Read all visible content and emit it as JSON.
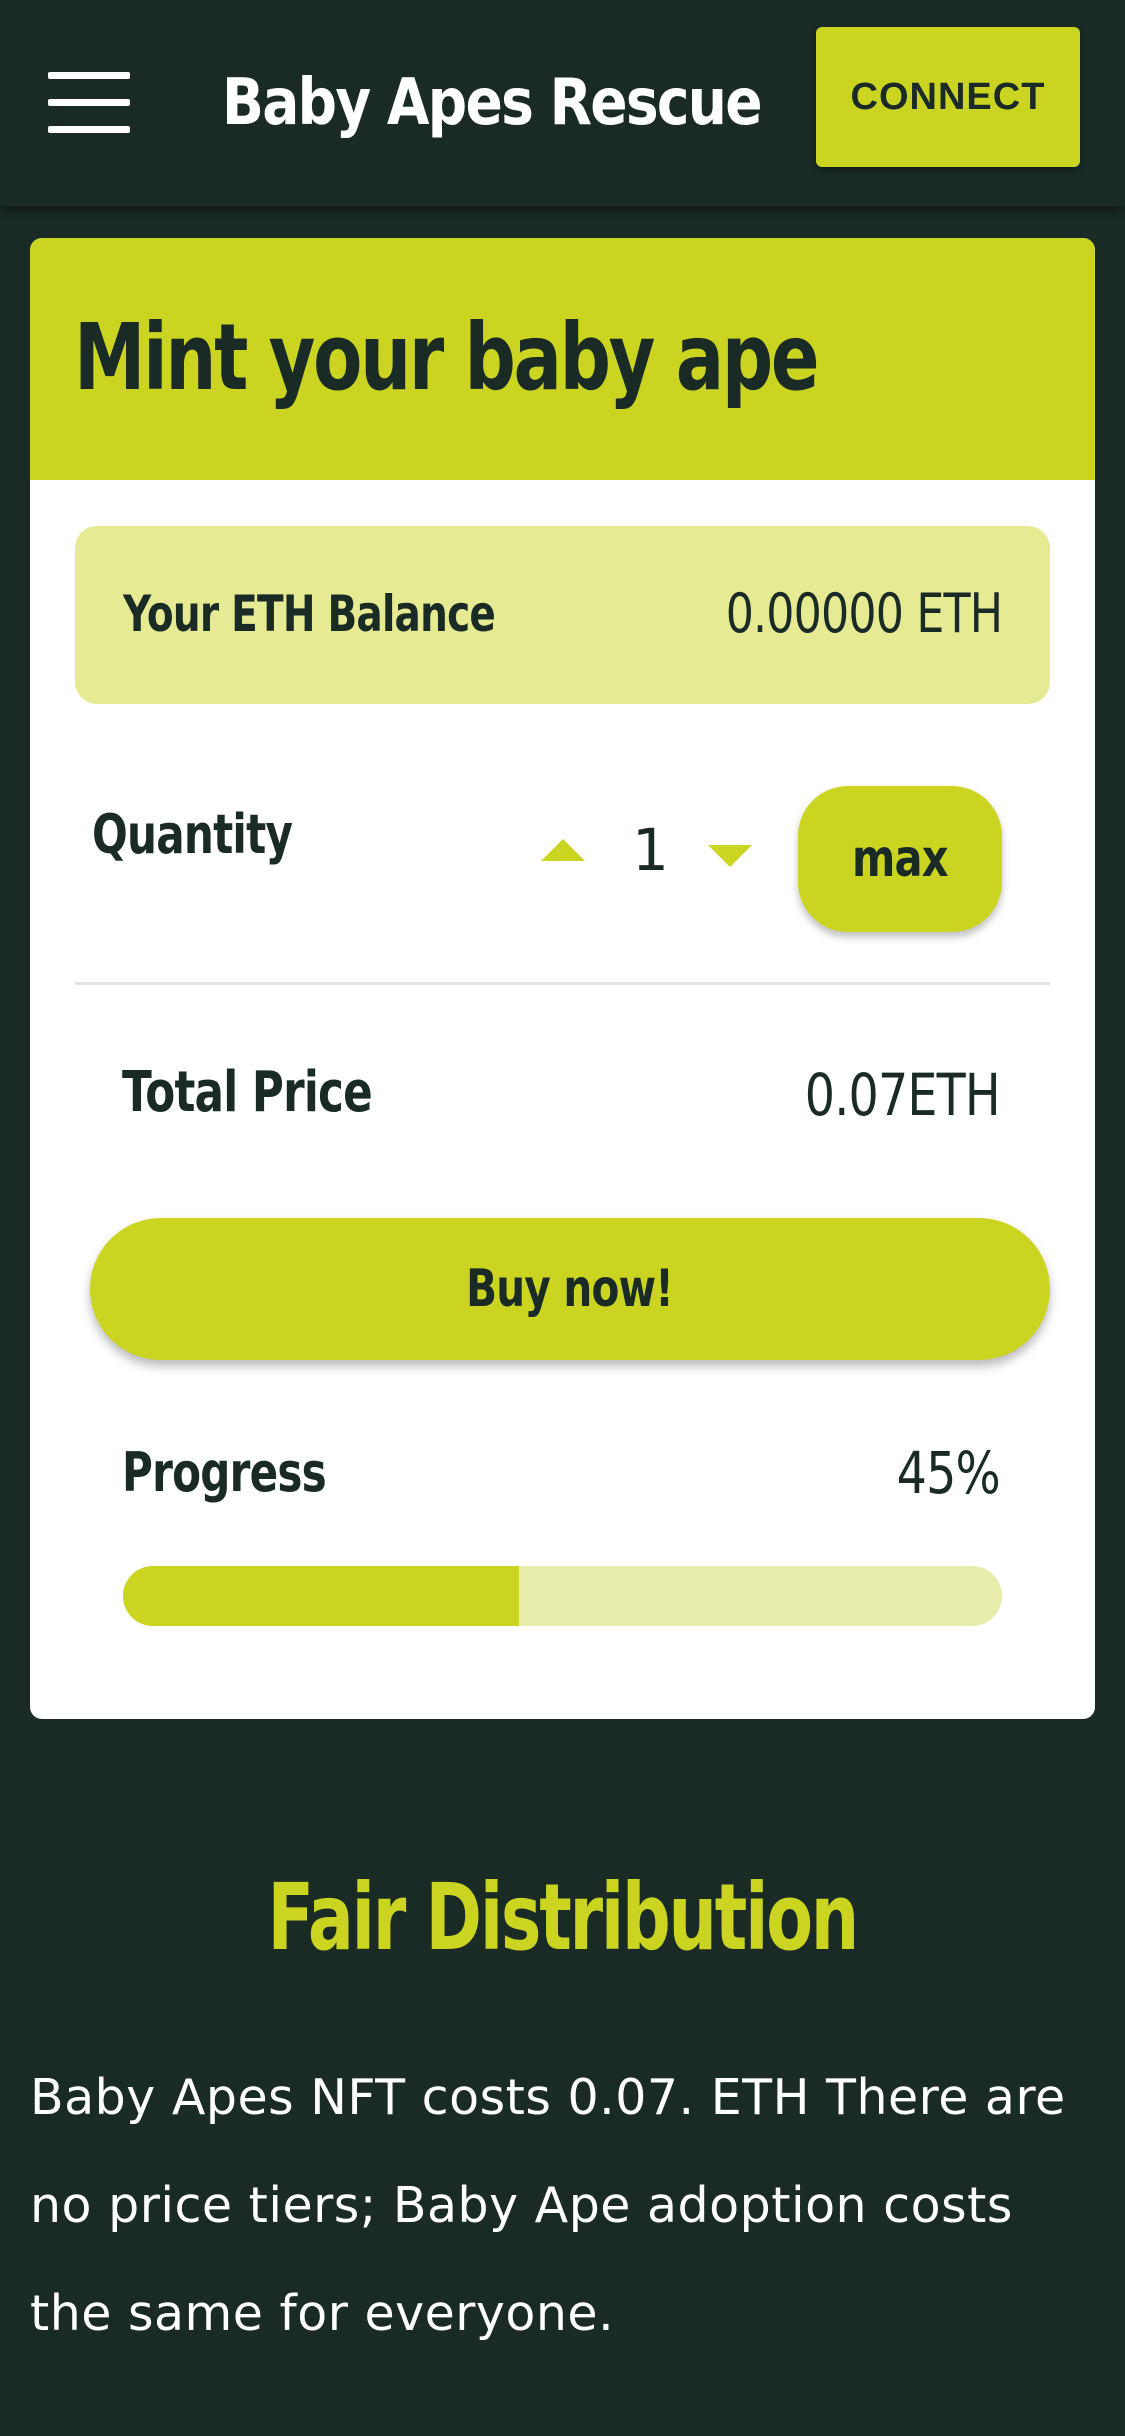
{
  "header": {
    "menu_icon": "hamburger-menu-icon",
    "brand": "Baby Apes Rescue",
    "connect_label": "CONNECT"
  },
  "mint_card": {
    "title": "Mint your baby ape",
    "balance": {
      "label": "Your ETH Balance",
      "value": "0.00000 ETH"
    },
    "quantity": {
      "label": "Quantity",
      "value": "1",
      "increment_icon": "triangle-up-icon",
      "decrement_icon": "triangle-down-icon",
      "max_label": "max"
    },
    "total_price": {
      "label": "Total Price",
      "value": "0.07ETH"
    },
    "buy_label": "Buy now!",
    "progress": {
      "label": "Progress",
      "percent_text": "45%",
      "percent": 45
    }
  },
  "distribution": {
    "title": "Fair Distribution",
    "body": "Baby Apes NFT costs 0.07. ETH There are no price tiers; Baby Ape adoption costs the same for everyone."
  },
  "colors": {
    "background": "#1a2b26",
    "accent": "#cbd420",
    "accent_light": "#e5ea93",
    "progress_track": "#e8ecaa",
    "text_dark": "#1a2b26",
    "text_light": "#ffffff"
  }
}
